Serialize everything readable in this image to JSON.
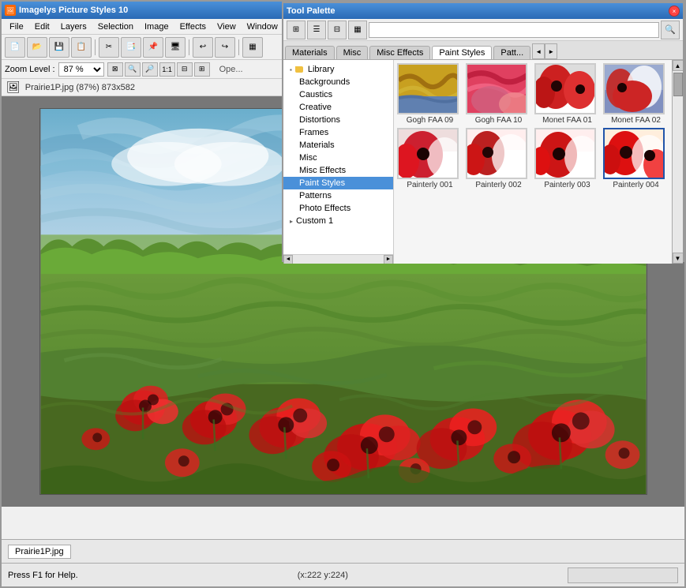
{
  "app": {
    "title": "Imagelys Picture Styles 10",
    "title_short": "Imagelys Picture Styles 10"
  },
  "tool_palette": {
    "title": "Tool Palette"
  },
  "menu": {
    "items": [
      "File",
      "Edit",
      "Layers",
      "Selection",
      "Image",
      "Effects",
      "View",
      "Window"
    ]
  },
  "toolbar": {
    "buttons": [
      "new",
      "open",
      "save",
      "save-as",
      "cut",
      "copy",
      "paste",
      "screenshot",
      "undo",
      "redo",
      "open2"
    ]
  },
  "zoom": {
    "label": "Zoom Level :",
    "value": "87 %",
    "open_label": "Ope..."
  },
  "file": {
    "name": "Prairie1P.jpg (87%) 873x582"
  },
  "status_bar": {
    "file_tab": "Prairie1P.jpg",
    "help_text": "Press F1 for Help.",
    "coords": "(x:222 y:224)"
  },
  "palette_tabs": {
    "tabs": [
      "Materials",
      "Misc",
      "Misc Effects",
      "Paint Styles",
      "Patt..."
    ],
    "active": "Paint Styles"
  },
  "tree": {
    "library_label": "Library",
    "items": [
      {
        "label": "Backgrounds",
        "indent": 1
      },
      {
        "label": "Caustics",
        "indent": 1
      },
      {
        "label": "Creative",
        "indent": 1
      },
      {
        "label": "Distortions",
        "indent": 1
      },
      {
        "label": "Frames",
        "indent": 1
      },
      {
        "label": "Materials",
        "indent": 1
      },
      {
        "label": "Misc",
        "indent": 1
      },
      {
        "label": "Misc Effects",
        "indent": 1
      },
      {
        "label": "Paint Styles",
        "indent": 1,
        "selected": true
      },
      {
        "label": "Patterns",
        "indent": 1
      },
      {
        "label": "Photo Effects",
        "indent": 1
      }
    ],
    "custom_items": [
      {
        "label": "Custom 1",
        "indent": 0
      }
    ]
  },
  "thumbnails": {
    "items": [
      {
        "label": "Gogh FAA 09",
        "selected": false,
        "colors": [
          "#c8a020",
          "#6080b0",
          "#d06010"
        ]
      },
      {
        "label": "Gogh FAA 10",
        "selected": false,
        "colors": [
          "#e04060",
          "#d06080",
          "#f09090"
        ]
      },
      {
        "label": "Monet FAA 01",
        "selected": false,
        "colors": [
          "#cc2020",
          "#dd4040",
          "#ffffff"
        ]
      },
      {
        "label": "Monet FAA 02",
        "selected": false,
        "colors": [
          "#8090c0",
          "#c03030",
          "#ffffff"
        ]
      },
      {
        "label": "Painterly 001",
        "selected": false,
        "colors": [
          "#cc2030",
          "#ffffff",
          "#ddbbbb"
        ]
      },
      {
        "label": "Painterly 002",
        "selected": false,
        "colors": [
          "#bb2020",
          "#ffffff",
          "#ffaaaa"
        ]
      },
      {
        "label": "Painterly 003",
        "selected": false,
        "colors": [
          "#cc1515",
          "#ffffff",
          "#ff9999"
        ]
      },
      {
        "label": "Painterly 004",
        "selected": true,
        "colors": [
          "#dd1010",
          "#ffffff",
          "#ffbbbb"
        ]
      }
    ]
  }
}
